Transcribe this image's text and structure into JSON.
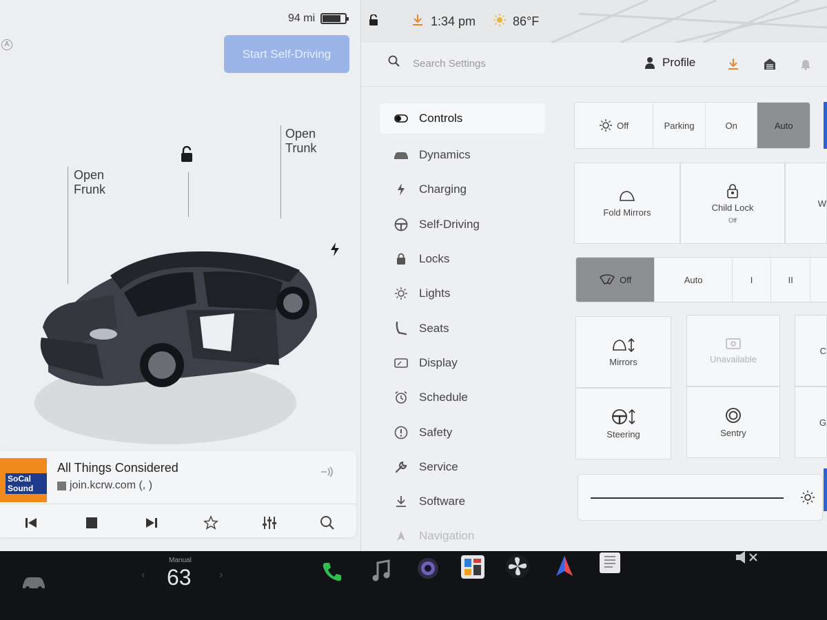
{
  "status": {
    "range": "94 mi",
    "battery_level": 0.8,
    "time": "1:34 pm",
    "temperature": "86°F"
  },
  "car_panel": {
    "start_button": "Start Self-Driving",
    "frunk": {
      "line1": "Open",
      "line2": "Frunk"
    },
    "trunk": {
      "line1": "Open",
      "line2": "Trunk"
    }
  },
  "media": {
    "title": "All Things Considered",
    "source": "join.kcrw.com (, )",
    "album_text": "SoCal Sound"
  },
  "header": {
    "search_placeholder": "Search Settings",
    "profile_label": "Profile"
  },
  "nav": {
    "items": [
      {
        "label": "Controls",
        "icon": "toggle-icon"
      },
      {
        "label": "Dynamics",
        "icon": "car-icon"
      },
      {
        "label": "Charging",
        "icon": "bolt-icon"
      },
      {
        "label": "Self-Driving",
        "icon": "steering-wheel-icon"
      },
      {
        "label": "Locks",
        "icon": "lock-icon"
      },
      {
        "label": "Lights",
        "icon": "light-icon"
      },
      {
        "label": "Seats",
        "icon": "seat-icon"
      },
      {
        "label": "Display",
        "icon": "display-icon"
      },
      {
        "label": "Schedule",
        "icon": "alarm-icon"
      },
      {
        "label": "Safety",
        "icon": "safety-icon"
      },
      {
        "label": "Service",
        "icon": "wrench-icon"
      },
      {
        "label": "Software",
        "icon": "download-icon"
      },
      {
        "label": "Navigation",
        "icon": "navigation-icon"
      }
    ]
  },
  "controls": {
    "lights": [
      "Off",
      "Parking",
      "On",
      "Auto"
    ],
    "lights_selected": "Auto",
    "fold_mirrors": "Fold Mirrors",
    "child_lock": {
      "label": "Child Lock",
      "state": "Off"
    },
    "partial_tile_letter": "W",
    "wipers": [
      "Off",
      "Auto",
      "I",
      "II"
    ],
    "wipers_selected": "Off",
    "mirrors": "Mirrors",
    "unavailable": "Unavailable",
    "steering": "Steering",
    "sentry": "Sentry",
    "partial_letter_1": "C",
    "partial_letter_2": "G",
    "brightness_level": 1.0
  },
  "dock": {
    "temp_mode": "Manual",
    "temp_value": "63"
  }
}
